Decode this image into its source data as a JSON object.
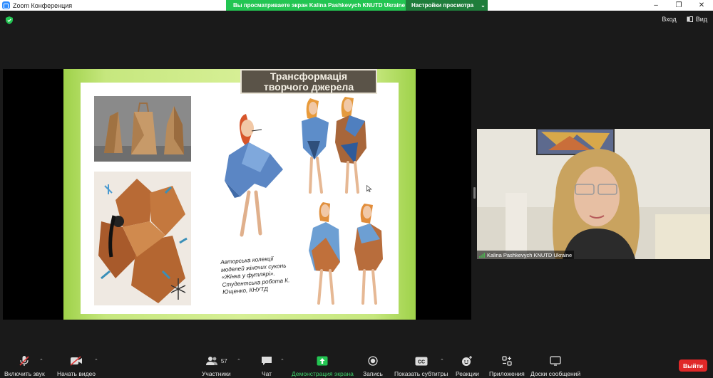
{
  "window": {
    "title": "Zoom Конференция",
    "share_banner": "Вы просматриваете экран Kalina Pashkevych KNUTD Ukraine",
    "view_settings": "Настройки просмотра"
  },
  "top_right": {
    "exit_label": "Вход",
    "view_label": "Вид"
  },
  "slide": {
    "title_line1": "Трансформація",
    "title_line2": "творчого джерела",
    "caption": "Авторська колекції моделей жіночих суконь «Жінка у футлярі». Студентська робота К. Ющенко, КНУТД"
  },
  "participant": {
    "name": "Kalina Pashkevych KNUTD Ukraine"
  },
  "toolbar": {
    "mute_label": "Включить звук",
    "video_label": "Начать видео",
    "participants_label": "Участники",
    "participants_count": "57",
    "chat_label": "Чат",
    "share_label": "Демонстрация экрана",
    "record_label": "Запись",
    "captions_label": "Показать субтитры",
    "reactions_label": "Реакции",
    "apps_label": "Приложения",
    "whiteboard_label": "Доски сообщений",
    "end_label": "Выйти"
  },
  "colors": {
    "share_green": "#23c552",
    "end_red": "#e02828",
    "slide_green": "#9fd24a",
    "title_box": "#5a5348"
  }
}
